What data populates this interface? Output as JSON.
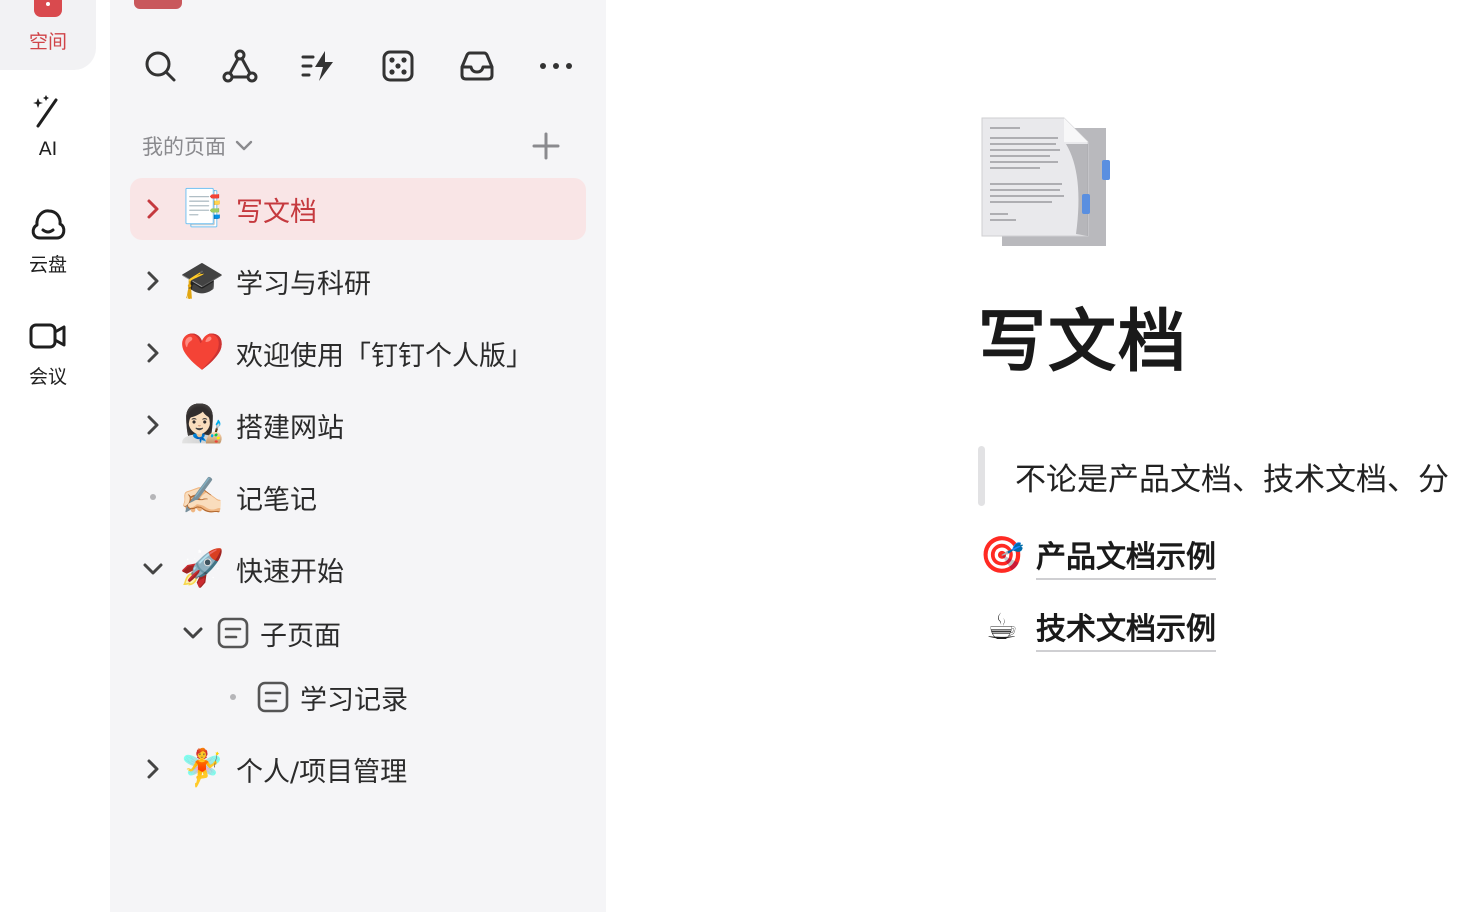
{
  "rail": {
    "items": [
      {
        "label": "空间",
        "icon": "space-icon",
        "active": true
      },
      {
        "label": "AI",
        "icon": "magic-wand-icon"
      },
      {
        "label": "云盘",
        "icon": "cloud-icon"
      },
      {
        "label": "会议",
        "icon": "video-camera-icon"
      }
    ]
  },
  "sidebar": {
    "toolbar": [
      "search-icon",
      "graph-icon",
      "quick-actions-icon",
      "dice-icon",
      "inbox-icon",
      "more-icon"
    ],
    "section_title": "我的页面",
    "tree": [
      {
        "emoji": "📑",
        "title": "写文档",
        "state": "collapsed",
        "selected": true
      },
      {
        "emoji": "🎓",
        "title": "学习与科研",
        "state": "collapsed"
      },
      {
        "emoji": "❤️",
        "title": "欢迎使用「钉钉个人版」",
        "state": "collapsed"
      },
      {
        "emoji": "👩🏻‍🎨",
        "title": "搭建网站",
        "state": "collapsed"
      },
      {
        "emoji": "✍🏻",
        "title": "记笔记",
        "state": "leaf"
      },
      {
        "emoji": "🚀",
        "title": "快速开始",
        "state": "expanded"
      },
      {
        "emoji": "",
        "title": "子页面",
        "state": "expanded"
      },
      {
        "emoji": "",
        "title": "学习记录",
        "state": "leaf"
      },
      {
        "emoji": "🧚",
        "title": "个人/项目管理",
        "state": "collapsed"
      }
    ]
  },
  "main": {
    "title": "写文档",
    "quote": "不论是产品文档、技术文档、分",
    "links": [
      {
        "emoji": "🎯",
        "label": "产品文档示例"
      },
      {
        "emoji": "☕",
        "label": "技术文档示例"
      }
    ]
  },
  "colors": {
    "accent": "#d04448",
    "selected_bg": "#f9e5e6",
    "sidebar_bg": "#f5f5f7"
  }
}
